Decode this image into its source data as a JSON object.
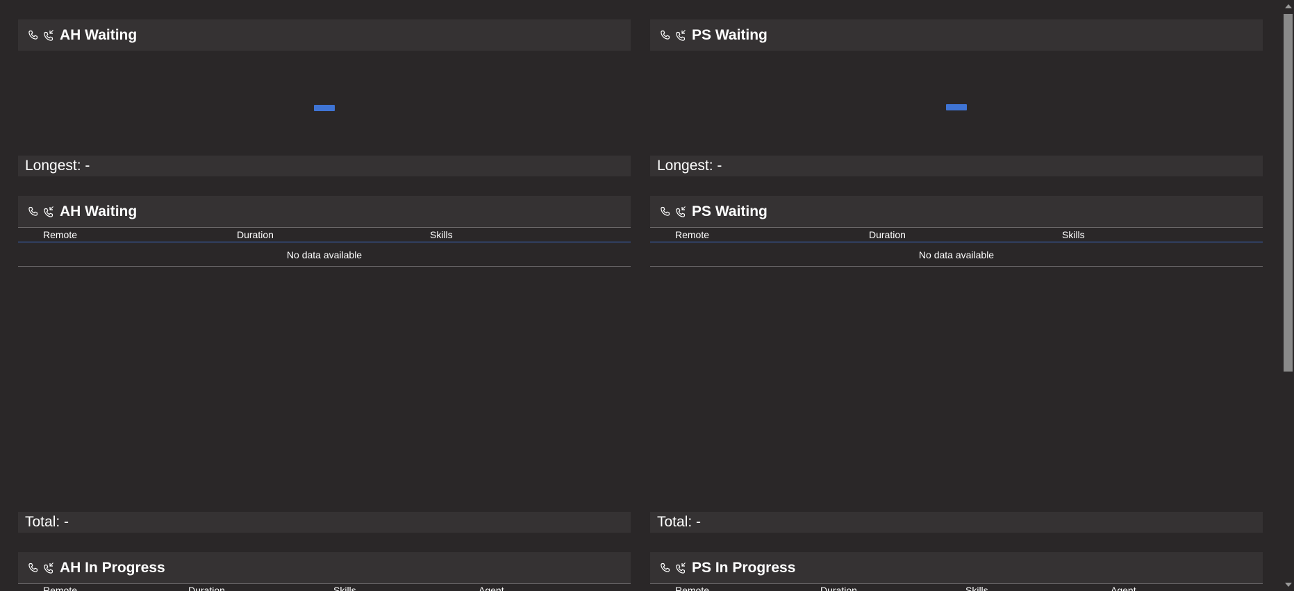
{
  "panels": {
    "ah_waiting_chart": {
      "title": "AH Waiting",
      "footer": "Longest: -"
    },
    "ps_waiting_chart": {
      "title": "PS Waiting",
      "footer": "Longest: -"
    },
    "ah_waiting_table": {
      "title": "AH Waiting",
      "columns": [
        "Remote",
        "Duration",
        "Skills"
      ],
      "empty_text": "No data available",
      "footer": "Total: -"
    },
    "ps_waiting_table": {
      "title": "PS Waiting",
      "columns": [
        "Remote",
        "Duration",
        "Skills"
      ],
      "empty_text": "No data available",
      "footer": "Total: -"
    },
    "ah_in_progress": {
      "title": "AH In Progress",
      "columns": [
        "Remote",
        "Duration",
        "Skills",
        "Agent"
      ]
    },
    "ps_in_progress": {
      "title": "PS In Progress",
      "columns": [
        "Remote",
        "Duration",
        "Skills",
        "Agent"
      ]
    }
  },
  "icons": {
    "phone": "phone-icon",
    "phone_incoming": "phone-incoming-icon"
  },
  "colors": {
    "background": "#2a2728",
    "panel_header": "#353233",
    "accent_blue": "#3f74d4"
  }
}
